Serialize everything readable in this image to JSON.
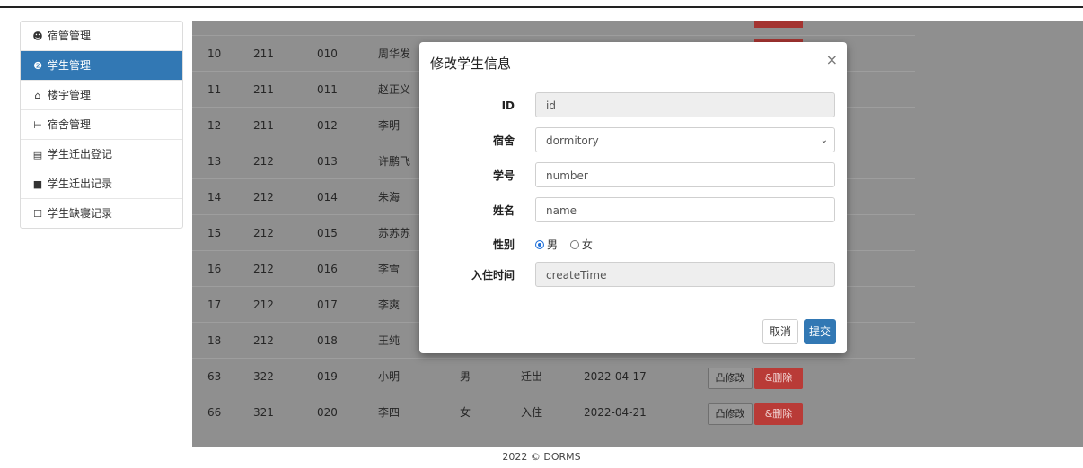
{
  "sidebar": {
    "items": [
      {
        "icon": "user-circle-icon",
        "glyph": "☻",
        "label": "宿管管理"
      },
      {
        "icon": "user-circle-icon",
        "glyph": "❷",
        "label": "学生管理"
      },
      {
        "icon": "home-icon",
        "glyph": "⌂",
        "label": "楼宇管理"
      },
      {
        "icon": "bed-icon",
        "glyph": "⊢",
        "label": "宿舍管理"
      },
      {
        "icon": "id-card-icon",
        "glyph": "▤",
        "label": "学生迁出登记"
      },
      {
        "icon": "bookmark-icon",
        "glyph": "■",
        "label": "学生迁出记录"
      },
      {
        "icon": "bookmark-outline-icon",
        "glyph": "☐",
        "label": "学生缺寝记录"
      }
    ],
    "active_index": 1
  },
  "table": {
    "rows": [
      {
        "id": "10",
        "dorm": "211",
        "number": "010",
        "name": "周华发",
        "gender": "",
        "state": "",
        "date": ""
      },
      {
        "id": "11",
        "dorm": "211",
        "number": "011",
        "name": "赵正义",
        "gender": "",
        "state": "",
        "date": ""
      },
      {
        "id": "12",
        "dorm": "211",
        "number": "012",
        "name": "李明",
        "gender": "",
        "state": "",
        "date": ""
      },
      {
        "id": "13",
        "dorm": "212",
        "number": "013",
        "name": "许鹏飞",
        "gender": "",
        "state": "",
        "date": ""
      },
      {
        "id": "14",
        "dorm": "212",
        "number": "014",
        "name": "朱海",
        "gender": "",
        "state": "",
        "date": ""
      },
      {
        "id": "15",
        "dorm": "212",
        "number": "015",
        "name": "苏苏苏",
        "gender": "",
        "state": "",
        "date": ""
      },
      {
        "id": "16",
        "dorm": "212",
        "number": "016",
        "name": "李雪",
        "gender": "",
        "state": "",
        "date": ""
      },
      {
        "id": "17",
        "dorm": "212",
        "number": "017",
        "name": "李爽",
        "gender": "",
        "state": "",
        "date": ""
      },
      {
        "id": "18",
        "dorm": "212",
        "number": "018",
        "name": "王纯",
        "gender": "",
        "state": "",
        "date": ""
      },
      {
        "id": "63",
        "dorm": "322",
        "number": "019",
        "name": "小明",
        "gender": "男",
        "state": "迁出",
        "date": "2022-04-17",
        "edit_label": "凸修改",
        "delete_label": "&删除"
      },
      {
        "id": "66",
        "dorm": "321",
        "number": "020",
        "name": "李四",
        "gender": "女",
        "state": "入住",
        "date": "2022-04-21",
        "edit_label": "凸修改",
        "delete_label": "&删除"
      }
    ]
  },
  "footer": {
    "text": "2022 © DORMS"
  },
  "modal": {
    "title": "修改学生信息",
    "close_label": "×",
    "fields": {
      "id": {
        "label": "ID",
        "value": "id"
      },
      "dormitory": {
        "label": "宿舍",
        "value": "dormitory"
      },
      "number": {
        "label": "学号",
        "value": "number"
      },
      "name": {
        "label": "姓名",
        "value": "name"
      },
      "gender": {
        "label": "性别",
        "options": [
          "男",
          "女"
        ],
        "selected": "男"
      },
      "create_time": {
        "label": "入住时间",
        "value": "createTime"
      }
    },
    "cancel_label": "取消",
    "submit_label": "提交"
  },
  "colors": {
    "primary": "#3278b4",
    "danger": "#b93b37",
    "backdrop": "#8f8f8f"
  }
}
